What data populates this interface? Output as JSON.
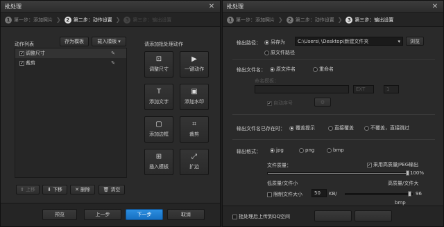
{
  "left": {
    "title": "批处理",
    "close": "✕",
    "steps": [
      {
        "num": "1",
        "label": "第一步：添加照片"
      },
      {
        "num": "2",
        "label": "第二步：动作设置"
      },
      {
        "num": "3",
        "label": "第三步：输出设置"
      }
    ],
    "action_list_title": "动作列表",
    "save_template": "存为模板",
    "load_template": "载入模板",
    "actions": [
      {
        "label": "调整尺寸",
        "checked": true
      },
      {
        "label": "裁剪",
        "checked": true
      }
    ],
    "list_buttons": {
      "up": "上移",
      "down": "下移",
      "delete": "删除",
      "clear": "清空"
    },
    "add_prompt": "请添加批处理动作",
    "tiles": [
      {
        "label": "调整尺寸",
        "icon": "resize-icon"
      },
      {
        "label": "一键动作",
        "icon": "play-icon"
      },
      {
        "label": "添加文字",
        "icon": "text-icon"
      },
      {
        "label": "添加水印",
        "icon": "watermark-icon"
      },
      {
        "label": "添加边框",
        "icon": "frame-icon"
      },
      {
        "label": "裁剪",
        "icon": "crop-icon"
      },
      {
        "label": "插入模板",
        "icon": "template-icon"
      },
      {
        "label": "扩边",
        "icon": "expand-icon"
      }
    ],
    "footer": {
      "preview": "预览",
      "prev": "上一步",
      "next": "下一步",
      "cancel": "取消"
    }
  },
  "right": {
    "title": "批处理",
    "close": "✕",
    "steps": [
      {
        "num": "1",
        "label": "第一步：添加照片"
      },
      {
        "num": "2",
        "label": "第二步：动作设置"
      },
      {
        "num": "3",
        "label": "第三步：输出设置"
      }
    ],
    "output_path_label": "输出路径：",
    "save_as": "另存为",
    "path_value": "C:\\Users\\       \\Desktop\\新建文件夹",
    "browse": "浏览",
    "original_path": "原文件路径",
    "filename_label": "输出文件名：",
    "original_name": "原文件名",
    "rename": "重命名",
    "template_label": "命名模板：",
    "ext_value": "EXT",
    "serial_value": "1",
    "serial_check": "自动序号",
    "exists_label": "输出文件名已存在时：",
    "exists_options": [
      "覆盖提示",
      "直接覆盖",
      "不覆盖，直接跳过"
    ],
    "format_label": "输出格式：",
    "formats": [
      "jpg",
      "png",
      "bmp"
    ],
    "quality_label": "文件质量：",
    "hq_jpeg": "采用高质量JPEG输出",
    "quality_value": "100%",
    "low_quality": "低质量/文件小",
    "high_quality": "高质量/文件大",
    "limit_size": "限制文件大小",
    "size_value": "50",
    "size_unit": "KB/",
    "resolution_value": "96",
    "resolution_unit": "bmp",
    "upload_check": "批处理后上传到QQ空间",
    "quality_fill": 1.0
  }
}
